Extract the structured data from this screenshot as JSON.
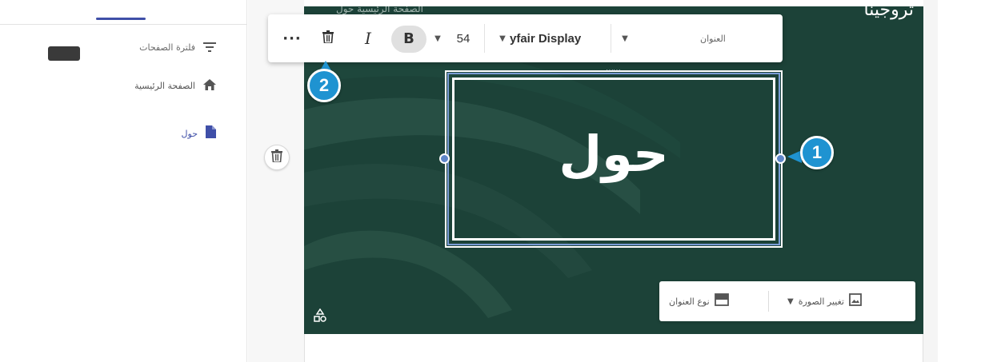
{
  "left_panel": {
    "filter_label": "فلترة الصفحات",
    "pages": [
      {
        "label": "الصفحة الرئيسية",
        "icon": "home-icon"
      },
      {
        "label": "حول",
        "icon": "page-icon",
        "selected": true
      }
    ]
  },
  "banner": {
    "site_name": "تروجينا",
    "menu_ghost": "الصفحة الرئيسية حول",
    "title": "حول",
    "background_color": "#1c4238"
  },
  "toolbar": {
    "more_label": "···",
    "italic_label": "I",
    "bold_label": "B",
    "font_size": "54",
    "font_family": "yfair Display",
    "text_style": "العنوان"
  },
  "bottom_bar": {
    "change_image_label": "تغيير الصورة",
    "title_type_label": "نوع العنوان"
  },
  "callouts": [
    "1",
    "2"
  ],
  "colors": {
    "accent": "#3f4fa8",
    "selection": "#5f86c9",
    "callout": "#1f93d1"
  }
}
